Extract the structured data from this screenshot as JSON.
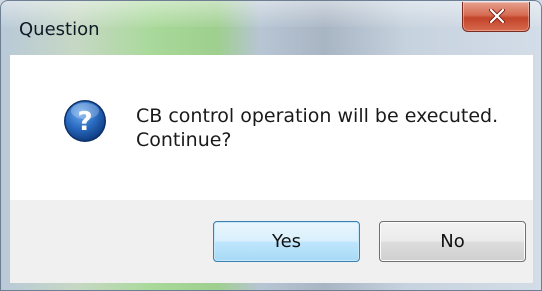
{
  "window": {
    "title": "Question",
    "close_icon": "close-icon"
  },
  "dialog": {
    "icon": "question-icon",
    "message_line1": "CB control operation will be executed.",
    "message_line2": "Continue?"
  },
  "buttons": {
    "yes_label": "Yes",
    "no_label": "No"
  },
  "colors": {
    "content_bg": "#ffffff",
    "button_area_bg": "#f0f0f0",
    "close_button": "#c2442a",
    "default_button_border": "#3c7fb1",
    "question_icon": "#1e5fb0"
  }
}
